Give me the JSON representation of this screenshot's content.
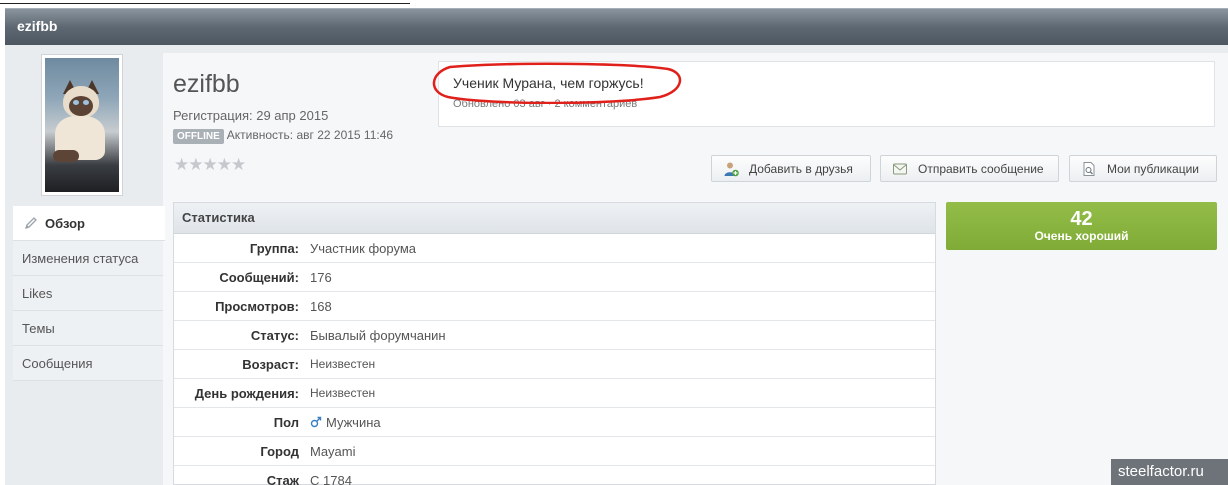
{
  "profile": {
    "title_name": "ezifbb",
    "username": "ezifbb",
    "registration": "Регистрация: 29 апр 2015",
    "offline_badge": "OFFLINE",
    "activity": "Активность: авг 22 2015 11:46",
    "stars": "★★★★★",
    "star_rating": 0
  },
  "status": {
    "text": "Ученик Мурана, чем горжусь!",
    "meta": "Обновлено 03 авг · 2 комментариев",
    "highlight_color": "#e0201a"
  },
  "actions": {
    "add_friend": "Добавить в друзья",
    "send_message": "Отправить сообщение",
    "my_posts": "Мои публикации"
  },
  "sidebar": {
    "items": [
      {
        "label": "Обзор",
        "active": true
      },
      {
        "label": "Изменения статуса"
      },
      {
        "label": "Likes"
      },
      {
        "label": "Темы"
      },
      {
        "label": "Сообщения"
      }
    ]
  },
  "stats": {
    "heading": "Статистика",
    "rows": [
      {
        "label": "Группа:",
        "value": "Участник форума"
      },
      {
        "label": "Сообщений:",
        "value": "176"
      },
      {
        "label": "Просмотров:",
        "value": "168"
      },
      {
        "label": "Статус:",
        "value": "Бывалый форумчанин"
      },
      {
        "label": "Возраст:",
        "value": "Неизвестен"
      },
      {
        "label": "День рождения:",
        "value": "Неизвестен"
      },
      {
        "label": "Пол",
        "value": "Мужчина"
      },
      {
        "label": "Город",
        "value": "Mayami"
      },
      {
        "label": "Стаж",
        "value": "С 1784"
      }
    ]
  },
  "reputation": {
    "value": "42",
    "label": "Очень хороший",
    "color": "#86b23c"
  },
  "watermark": "steelfactor.ru",
  "icons": {
    "nav_overview": "pencil-icon",
    "add_friend": "add-user-icon",
    "send_message": "message-icon",
    "my_posts": "document-search-icon",
    "gender": "male-icon"
  }
}
